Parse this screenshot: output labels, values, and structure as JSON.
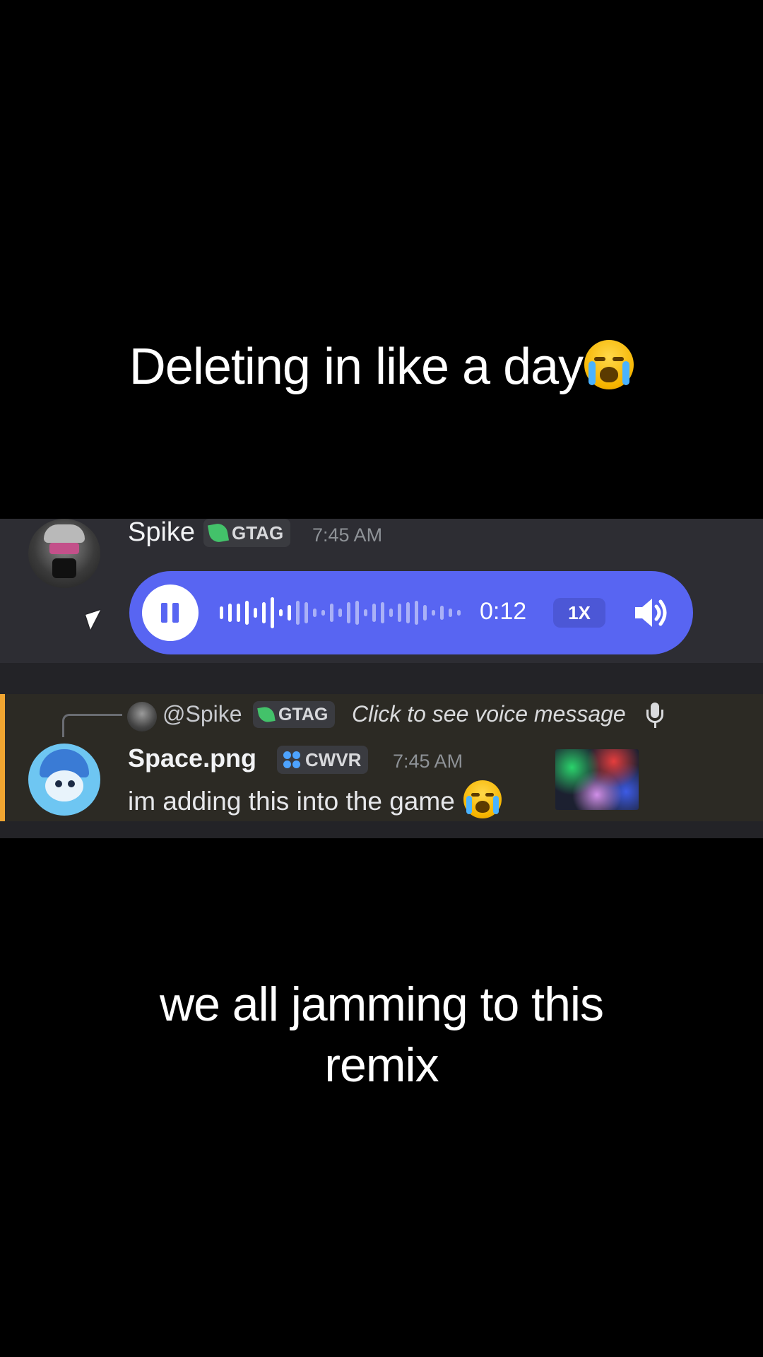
{
  "captions": {
    "top": "Deleting in like a day",
    "bottom_line1": "we all jamming to this",
    "bottom_line2": "remix"
  },
  "message1": {
    "author": "Spike",
    "tag": "GTAG",
    "time": "7:45 AM",
    "voice": {
      "elapsed": "0:12",
      "speed": "1X",
      "progress": 0.3
    }
  },
  "reply": {
    "mention": "@Spike",
    "tag": "GTAG",
    "text": "Click to see voice message"
  },
  "message2": {
    "author": "Space.png",
    "tag": "CWVR",
    "time": "7:45 AM",
    "text": "im adding this into the game"
  },
  "colors": {
    "voice_bg": "#5865f2",
    "reply_accent": "#f0a531",
    "gtag_leaf": "#43c26a"
  }
}
